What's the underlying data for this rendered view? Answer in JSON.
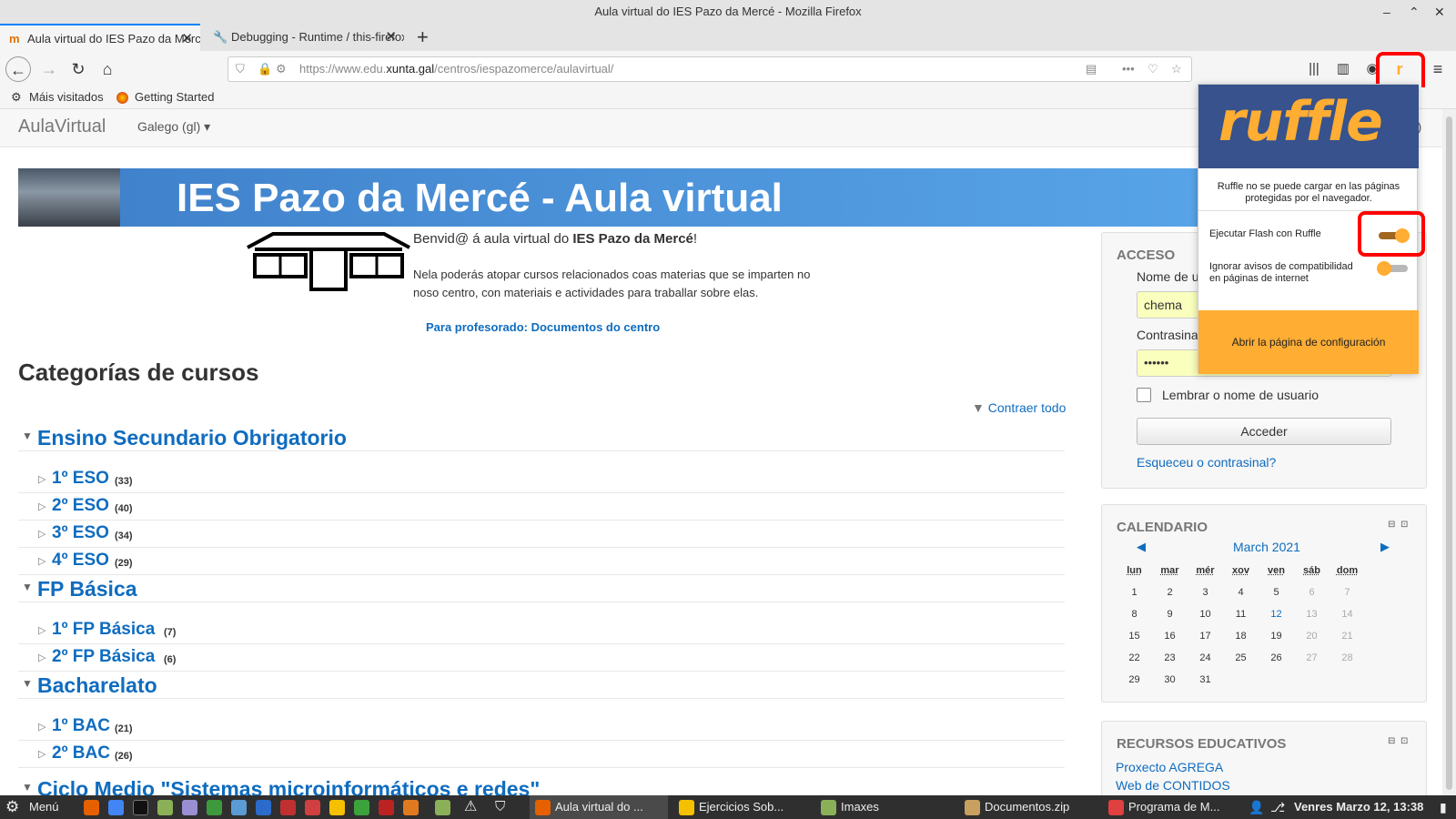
{
  "window": {
    "title": "Aula virtual do IES Pazo da Mercé - Mozilla Firefox"
  },
  "tabs": [
    {
      "label": "Aula virtual do IES Pazo da Mercé"
    },
    {
      "label": "Debugging - Runtime / this-firefox"
    }
  ],
  "url": {
    "prefix": "https://www.edu.",
    "domain": "xunta.gal",
    "path": "/centros/iespazomerce/aulavirtual/"
  },
  "bookmarks": [
    {
      "label": "Máis visitados"
    },
    {
      "label": "Getting Started"
    }
  ],
  "moodle": {
    "brand": "AulaVirtual",
    "language": "Galego (gl)",
    "login_partial": "ar)"
  },
  "banner": {
    "title": "IES Pazo da Mercé - Aula virtual"
  },
  "welcome": {
    "greeting_prefix": "Benvid@ á aula virtual do ",
    "school": "IES Pazo da Mercé",
    "greeting_suffix": "!",
    "description": "Nela poderás atopar cursos relacionados coas materias que se imparten no noso centro, con materiais e actividades para traballar sobre elas.",
    "teacher_link": "Para profesorado: Documentos do centro"
  },
  "categories": {
    "heading": "Categorías de cursos",
    "collapse_all": "Contraer todo",
    "groups": [
      {
        "name": "Ensino Secundario Obrigatorio",
        "items": [
          {
            "name": "1º ESO",
            "count": "(33)"
          },
          {
            "name": "2º ESO",
            "count": "(40)"
          },
          {
            "name": "3º ESO",
            "count": "(34)"
          },
          {
            "name": "4º ESO",
            "count": "(29)"
          }
        ]
      },
      {
        "name": "FP Básica",
        "items": [
          {
            "name": "1º FP Básica",
            "count": "(7)"
          },
          {
            "name": "2º FP Básica",
            "count": "(6)"
          }
        ]
      },
      {
        "name": "Bacharelato",
        "items": [
          {
            "name": "1º BAC",
            "count": "(21)"
          },
          {
            "name": "2º BAC",
            "count": "(26)"
          }
        ]
      },
      {
        "name": "Ciclo Medio \"Sistemas microinformáticos e redes\"",
        "items": []
      }
    ]
  },
  "login": {
    "heading": "ACCESO",
    "username_label": "Nome de u",
    "username_value": "chema",
    "password_label": "Contrasina",
    "password_value": "••••••",
    "remember": "Lembrar o nome de usuario",
    "submit": "Acceder",
    "forgot": "Esqueceu o contrasinal?"
  },
  "calendar": {
    "heading": "CALENDARIO",
    "month": "March 2021",
    "days": [
      "lun",
      "mar",
      "mér",
      "xov",
      "ven",
      "sáb",
      "dom"
    ],
    "weeks": [
      [
        "1",
        "2",
        "3",
        "4",
        "5",
        "6",
        "7"
      ],
      [
        "8",
        "9",
        "10",
        "11",
        "12",
        "13",
        "14"
      ],
      [
        "15",
        "16",
        "17",
        "18",
        "19",
        "20",
        "21"
      ],
      [
        "22",
        "23",
        "24",
        "25",
        "26",
        "27",
        "28"
      ],
      [
        "29",
        "30",
        "31",
        "",
        "",
        "",
        ""
      ]
    ],
    "today": "12"
  },
  "resources": {
    "heading": "RECURSOS EDUCATIVOS",
    "links": [
      "Proxecto AGREGA",
      "Web de CONTIDOS"
    ]
  },
  "ruffle": {
    "logo": "ruffle",
    "notice": "Ruffle no se puede cargar en las páginas protegidas por el navegador.",
    "toggle1": "Ejecutar Flash con Ruffle",
    "toggle1_on": true,
    "toggle2": "Ignorar avisos de compatibilidad en páginas de internet",
    "toggle2_on": false,
    "settings_button": "Abrir la página de configuración"
  },
  "taskbar": {
    "menu": "Menú",
    "apps": [
      {
        "label": "Aula virtual do ...",
        "color": "#e66000"
      },
      {
        "label": "Ejercicios Sob...",
        "color": "#f5c000"
      },
      {
        "label": "Imaxes",
        "color": "#8bb158"
      },
      {
        "label": "Documentos.zip",
        "color": "#c8a060"
      },
      {
        "label": "Programa de M...",
        "color": "#e04040"
      }
    ],
    "clock": "Venres Marzo 12, 13:38"
  },
  "colors": {
    "accent": "#0f6cbf",
    "ruffle_orange": "#ffad33",
    "ruffle_blue": "#37528c",
    "banner_blue": "#4a90d9",
    "highlight_red": "#ff0000"
  }
}
